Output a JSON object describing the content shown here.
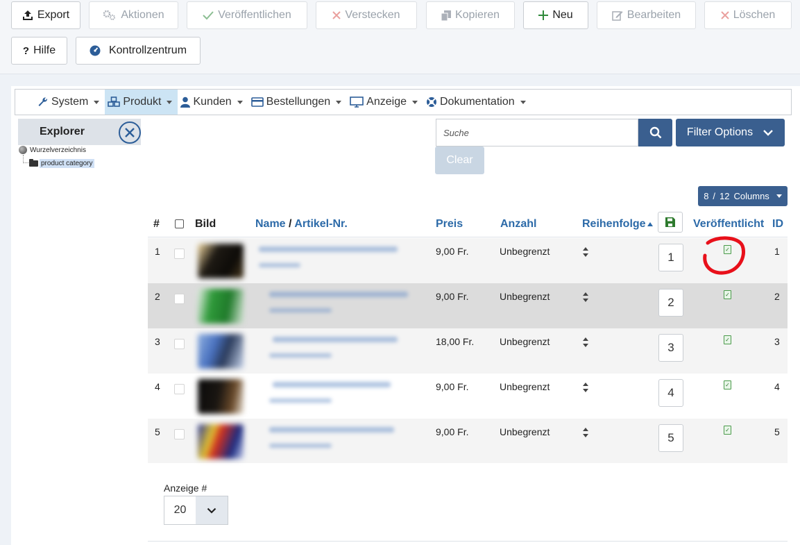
{
  "toolbar": {
    "export": "Export",
    "aktionen": "Aktionen",
    "veroeffentlichen": "Veröffentlichen",
    "verstecken": "Verstecken",
    "kopieren": "Kopieren",
    "neu": "Neu",
    "bearbeiten": "Bearbeiten",
    "loeschen": "Löschen",
    "hilfe": "Hilfe",
    "kontrollzentrum": "Kontrollzentrum"
  },
  "menu": {
    "items": [
      {
        "label": "System",
        "icon": "wrench-icon"
      },
      {
        "label": "Produkt",
        "icon": "cubes-icon",
        "active": true
      },
      {
        "label": "Kunden",
        "icon": "user-icon"
      },
      {
        "label": "Bestellungen",
        "icon": "credit-card-icon"
      },
      {
        "label": "Anzeige",
        "icon": "desktop-icon"
      },
      {
        "label": "Dokumentation",
        "icon": "life-ring-icon"
      }
    ]
  },
  "explorer": {
    "title": "Explorer",
    "root": "Wurzelverzeichnis",
    "child": "product category"
  },
  "search": {
    "placeholder": "Suche",
    "filter_label": "Filter Options",
    "clear_label": "Clear"
  },
  "columns": {
    "label": "Columns",
    "shown": "8",
    "total": "12"
  },
  "table": {
    "headers": {
      "num": "#",
      "bild": "Bild",
      "name": "Name",
      "artikel": "Artikel-Nr.",
      "preis": "Preis",
      "anzahl": "Anzahl",
      "reihenfolge": "Reihenfolge",
      "veroeffentlicht": "Veröffentlicht",
      "id": "ID"
    },
    "rows": [
      {
        "num": "1",
        "preis": "9,00 Fr.",
        "anzahl": "Unbegrenzt",
        "order": "1",
        "id": "1"
      },
      {
        "num": "2",
        "preis": "9,00 Fr.",
        "anzahl": "Unbegrenzt",
        "order": "2",
        "id": "2"
      },
      {
        "num": "3",
        "preis": "18,00 Fr.",
        "anzahl": "Unbegrenzt",
        "order": "3",
        "id": "3"
      },
      {
        "num": "4",
        "preis": "9,00 Fr.",
        "anzahl": "Unbegrenzt",
        "order": "4",
        "id": "4"
      },
      {
        "num": "5",
        "preis": "9,00 Fr.",
        "anzahl": "Unbegrenzt",
        "order": "5",
        "id": "5"
      }
    ]
  },
  "footer": {
    "label": "Anzeige #",
    "page_size": "20"
  },
  "colors": {
    "primary": "#3a5f8f",
    "link": "#2c6aa8",
    "annotation": "#e8101a"
  }
}
